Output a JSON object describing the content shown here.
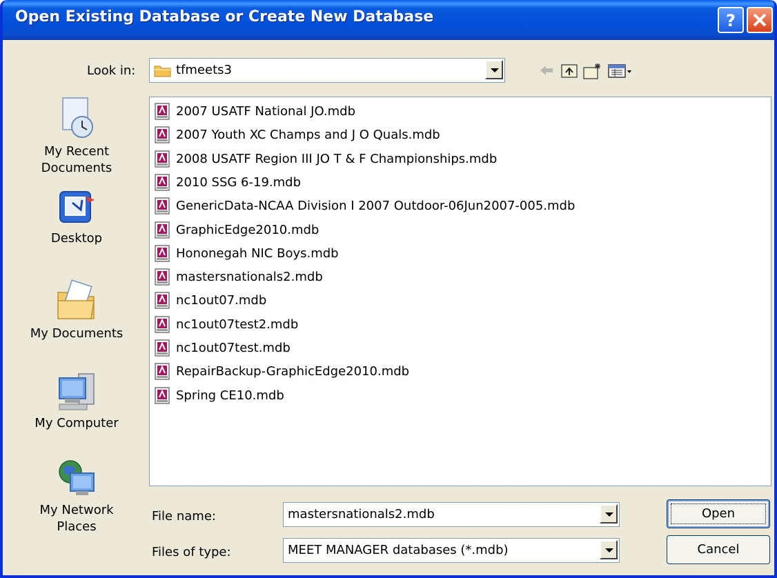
{
  "dialog": {
    "title": "Open Existing Database or Create New Database",
    "help_label": "?",
    "close_label": "×"
  },
  "look_in": {
    "label": "Look in:",
    "value": "tfmeets3",
    "folder_icon": "folder-icon"
  },
  "toolbar": [
    "back-icon",
    "up-folder-icon",
    "new-folder-icon",
    "views-menu-icon"
  ],
  "places": [
    {
      "label": "My Recent Documents",
      "line1": "My Recent",
      "line2": "Documents",
      "icon": "recent-documents-icon"
    },
    {
      "label": "Desktop",
      "line1": "Desktop",
      "line2": "",
      "icon": "desktop-icon"
    },
    {
      "label": "My Documents",
      "line1": "My Documents",
      "line2": "",
      "icon": "my-documents-icon"
    },
    {
      "label": "My Computer",
      "line1": "My Computer",
      "line2": "",
      "icon": "my-computer-icon"
    },
    {
      "label": "My Network Places",
      "line1": "My Network",
      "line2": "Places",
      "icon": "network-places-icon"
    }
  ],
  "files": [
    "2007 USATF National JO.mdb",
    "2007 Youth XC Champs and J O Quals.mdb",
    "2008 USATF Region III JO T & F Championships.mdb",
    "2010  SSG 6-19.mdb",
    "GenericData-NCAA Division I 2007 Outdoor-06Jun2007-005.mdb",
    "GraphicEdge2010.mdb",
    "Hononegah NIC Boys.mdb",
    "mastersnationals2.mdb",
    "nc1out07.mdb",
    "nc1out07test2.mdb",
    "nc1out07test.mdb",
    "RepairBackup-GraphicEdge2010.mdb",
    "Spring CE10.mdb"
  ],
  "file_name": {
    "label": "File name:",
    "value": "mastersnationals2.mdb"
  },
  "file_type": {
    "label": "Files of type:",
    "value": "MEET MANAGER databases (*.mdb)"
  },
  "buttons": {
    "open": "Open",
    "cancel": "Cancel"
  },
  "colors": {
    "titlebar": "#0A53DB",
    "dialog_bg": "#ECE9D8",
    "field_border": "#7F9DB9"
  }
}
